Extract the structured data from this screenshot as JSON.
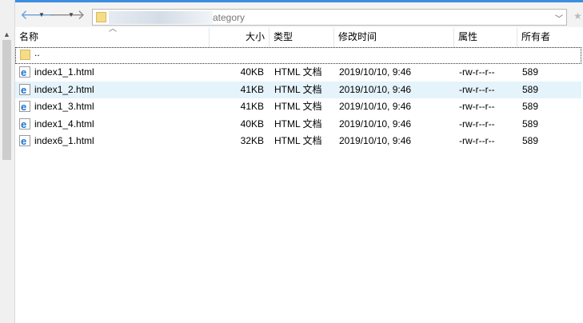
{
  "toolbar": {
    "path": "ategory"
  },
  "columns": {
    "name": "名称",
    "size": "大小",
    "type": "类型",
    "mtime": "修改时间",
    "attrs": "属性",
    "owner": "所有者"
  },
  "parent": {
    "name": ".."
  },
  "files": [
    {
      "name": "index1_1.html",
      "size": "40KB",
      "type": "HTML 文档",
      "mtime": "2019/10/10, 9:46",
      "attrs": "-rw-r--r--",
      "owner": "589"
    },
    {
      "name": "index1_2.html",
      "size": "41KB",
      "type": "HTML 文档",
      "mtime": "2019/10/10, 9:46",
      "attrs": "-rw-r--r--",
      "owner": "589"
    },
    {
      "name": "index1_3.html",
      "size": "41KB",
      "type": "HTML 文档",
      "mtime": "2019/10/10, 9:46",
      "attrs": "-rw-r--r--",
      "owner": "589"
    },
    {
      "name": "index1_4.html",
      "size": "40KB",
      "type": "HTML 文档",
      "mtime": "2019/10/10, 9:46",
      "attrs": "-rw-r--r--",
      "owner": "589"
    },
    {
      "name": "index6_1.html",
      "size": "32KB",
      "type": "HTML 文档",
      "mtime": "2019/10/10, 9:46",
      "attrs": "-rw-r--r--",
      "owner": "589"
    }
  ]
}
